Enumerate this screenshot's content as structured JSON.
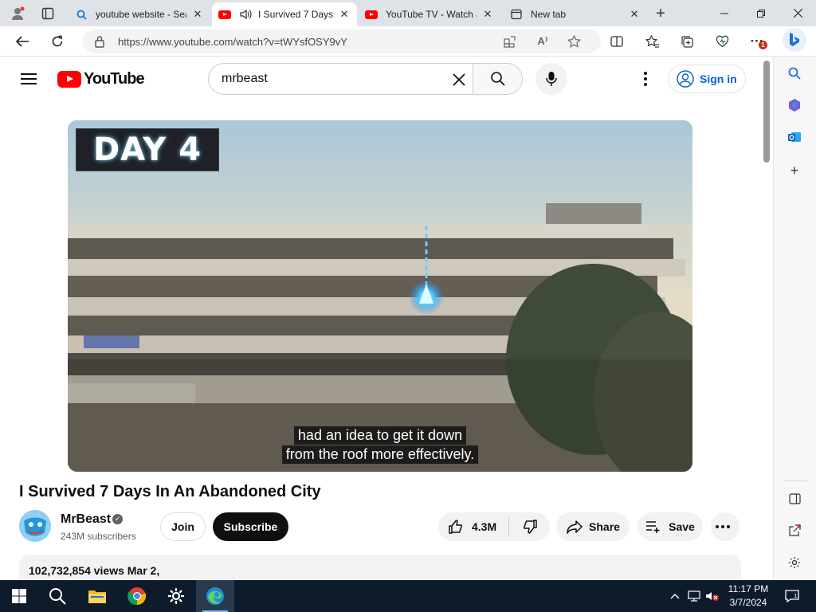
{
  "browser": {
    "tabs": [
      {
        "title": "youtube website - Sea",
        "icon": "search-icon",
        "active": false
      },
      {
        "title": "I Survived 7 Days",
        "icon": "youtube-icon",
        "active": true
      },
      {
        "title": "YouTube TV - Watch &",
        "icon": "youtube-icon",
        "active": false
      },
      {
        "title": "New tab",
        "icon": "newtab-icon",
        "active": false
      }
    ],
    "url": "https://www.youtube.com/watch?v=tWYsfOSY9vY",
    "notification_count": "1"
  },
  "youtube": {
    "logo_text": "YouTube",
    "search_query": "mrbeast",
    "sign_in_label": "Sign in",
    "player": {
      "badge_text": "DAY 4",
      "caption_lines": [
        "had an idea to get it down",
        "from the roof more effectively."
      ]
    },
    "video": {
      "title": "I Survived 7 Days In An Abandoned City",
      "channel_name": "MrBeast",
      "subscribers": "243M subscribers",
      "join_label": "Join",
      "subscribe_label": "Subscribe",
      "likes": "4.3M",
      "share_label": "Share",
      "save_label": "Save",
      "stats": "102,732,854 views  Mar 2,"
    }
  },
  "taskbar": {
    "time": "11:17 PM",
    "date": "3/7/2024"
  },
  "colors": {
    "youtube_red": "#ff0000",
    "link_blue": "#065fd4",
    "taskbar": "#0d1b2a"
  }
}
